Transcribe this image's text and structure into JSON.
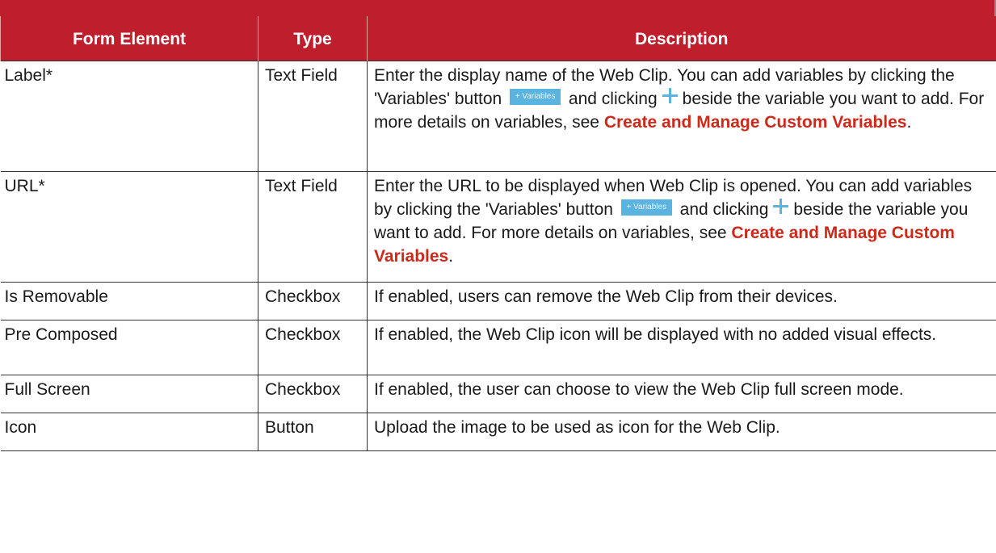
{
  "table": {
    "header_partial": "",
    "headers": {
      "element": "Form Element",
      "type": "Type",
      "description": "Description"
    },
    "rows": [
      {
        "element": "Label*",
        "type": "Text Field",
        "desc_1": "Enter the display name of the Web Clip. You can add variables by clicking the 'Variables' button",
        "button_label": "+ Variables",
        "desc_2": "and clicking",
        "desc_3": "beside the variable you want to add. For more details on variables, see",
        "link": "Create and Manage Custom Variables",
        "desc_end": "."
      },
      {
        "element": "URL*",
        "type": "Text Field",
        "desc_1": "Enter the URL to be displayed when Web Clip is opened. You can add variables by clicking the 'Variables' button",
        "button_label": "+ Variables",
        "desc_2": "and clicking",
        "desc_3": "beside the variable you want to add. For more details on variables, see",
        "link": "Create and Manage Custom Variables",
        "desc_end": "."
      },
      {
        "element": "Is Removable",
        "type": "Checkbox",
        "desc": "If enabled, users can remove the Web Clip from their devices."
      },
      {
        "element": "Pre Composed",
        "type": "Checkbox",
        "desc": "If enabled, the Web Clip icon will be displayed with no added visual effects."
      },
      {
        "element": "Full Screen",
        "type": "Checkbox",
        "desc": "If enabled, the user can choose to view the Web Clip full screen mode."
      },
      {
        "element": "Icon",
        "type": "Button",
        "desc": "Upload the image to be used as icon for the Web Clip."
      }
    ]
  },
  "colors": {
    "header_bg": "#bf1e2d",
    "link": "#cc2a1a",
    "variables_button": "#5bb3df"
  },
  "icons": [
    "plus-icon"
  ]
}
